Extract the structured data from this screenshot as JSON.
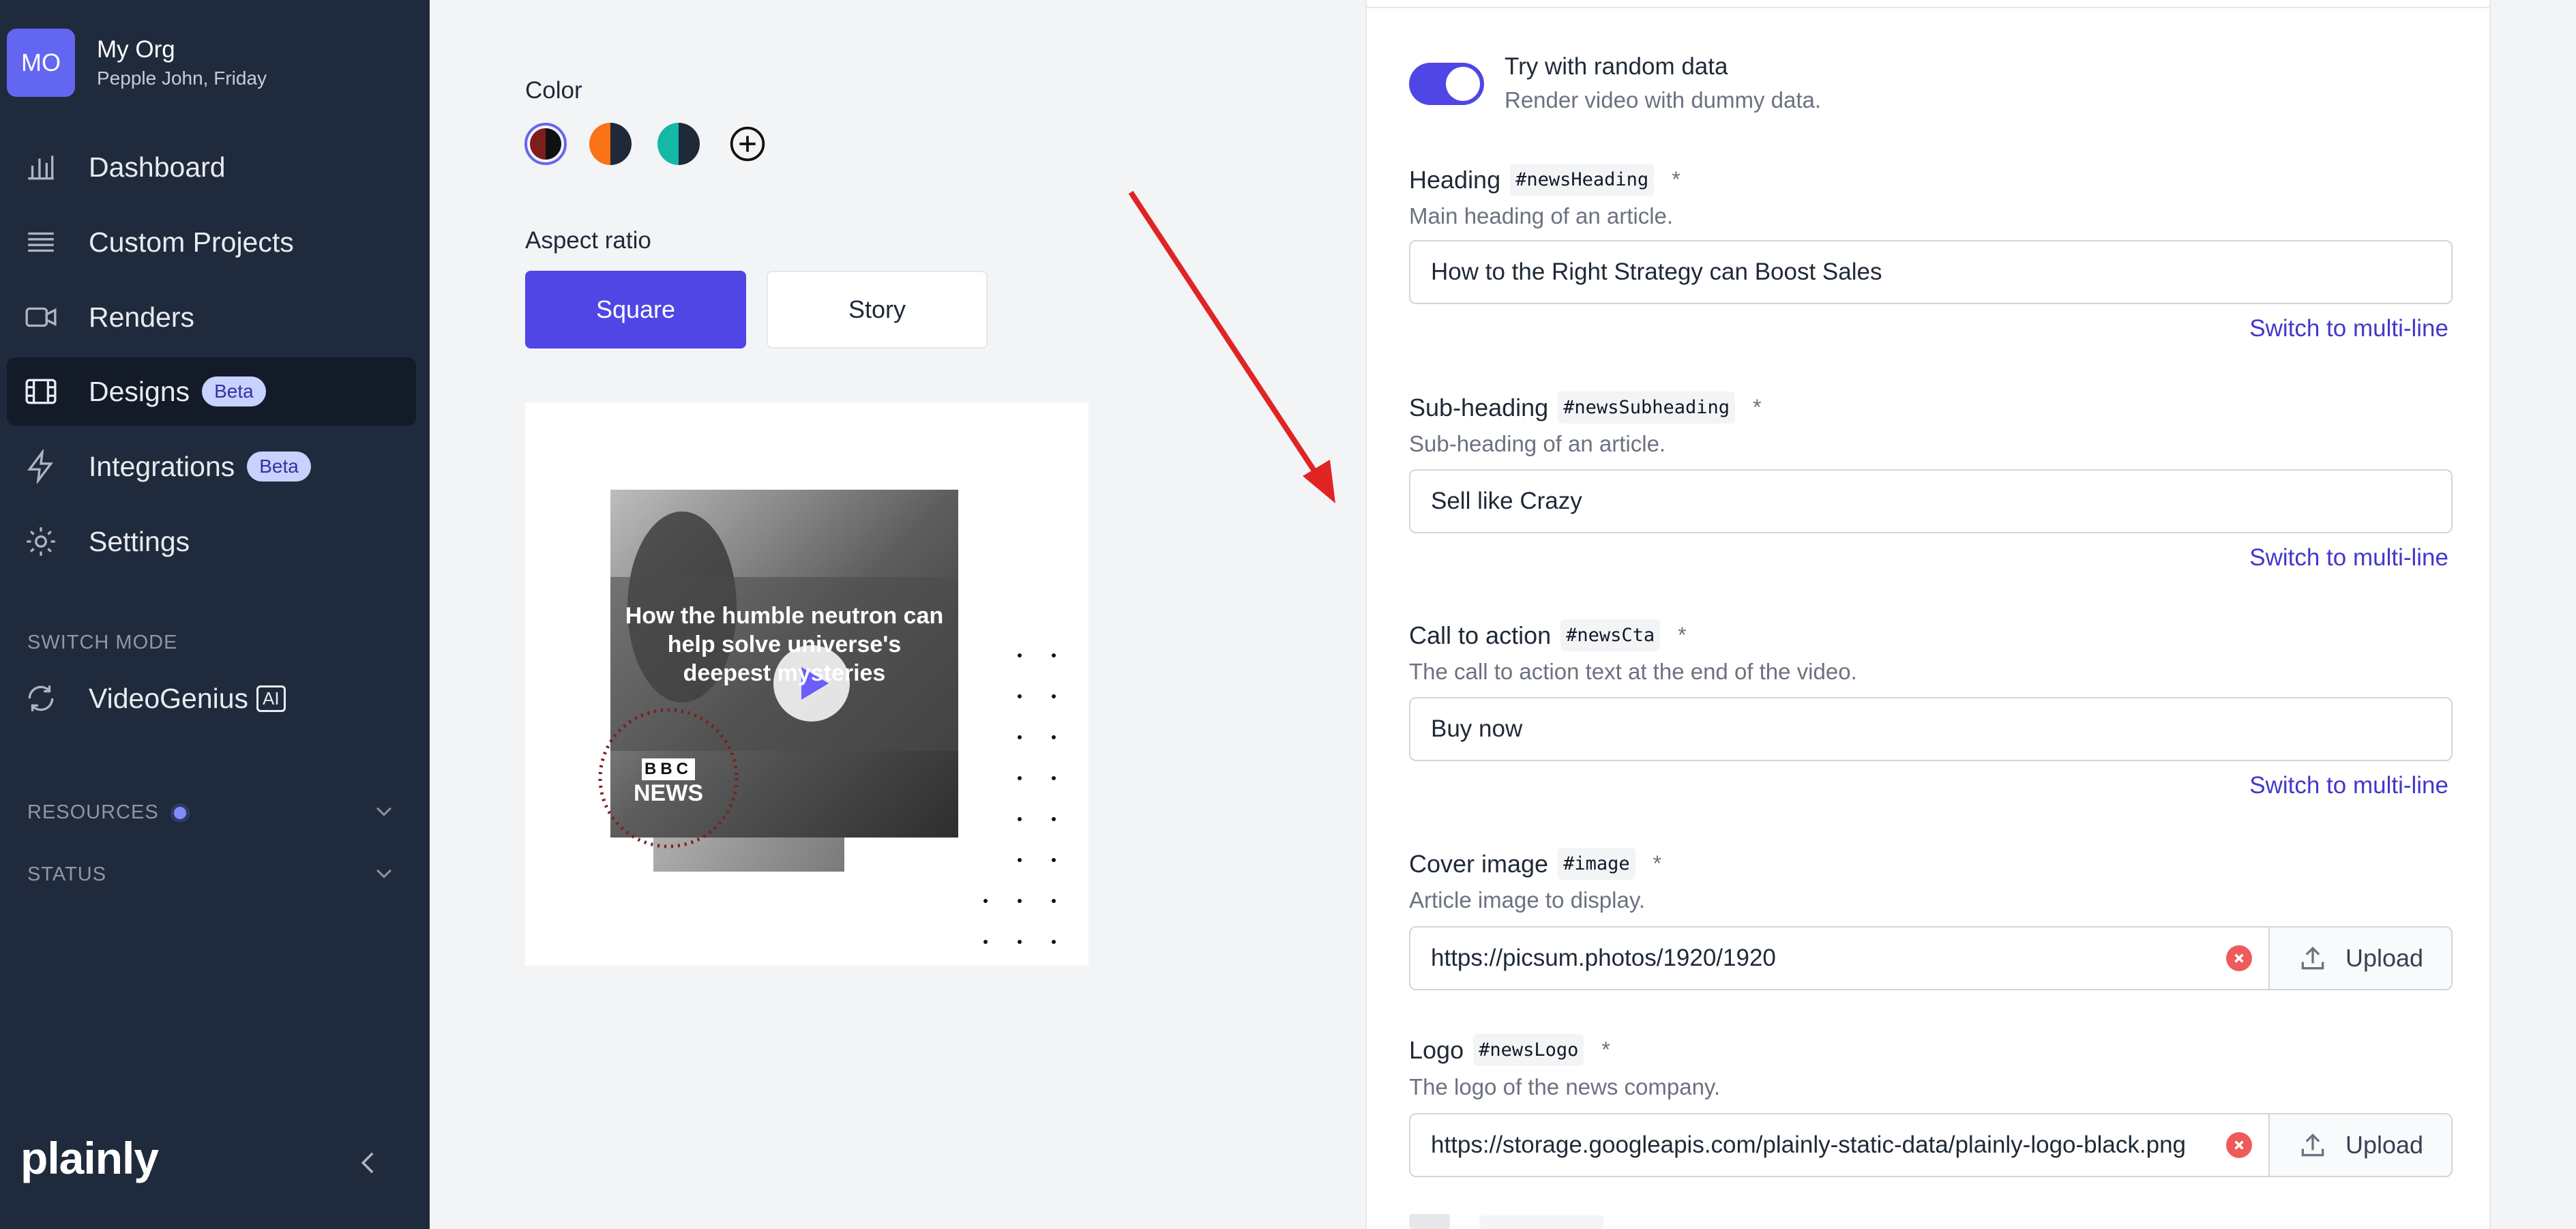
{
  "org": {
    "initials": "MO",
    "name": "My Org",
    "subtitle": "Pepple John, Friday"
  },
  "nav": {
    "dashboard": "Dashboard",
    "custom_projects": "Custom Projects",
    "renders": "Renders",
    "designs": "Designs",
    "designs_badge": "Beta",
    "integrations": "Integrations",
    "integrations_badge": "Beta",
    "settings": "Settings"
  },
  "switch_mode": {
    "label": "SWITCH MODE",
    "item": "VideoGenius",
    "badge": "AI"
  },
  "resources": {
    "label": "RESOURCES"
  },
  "status": {
    "label": "STATUS"
  },
  "brand": "plainly",
  "options": {
    "color_label": "Color",
    "colors": [
      {
        "left": "#7f1d1d",
        "right": "#111111"
      },
      {
        "left": "#f97316",
        "right": "#1f2937"
      },
      {
        "left": "#14b8a6",
        "right": "#1f2937"
      }
    ],
    "aspect_label": "Aspect ratio",
    "aspect_square": "Square",
    "aspect_story": "Story"
  },
  "preview": {
    "headline": "How the humble neutron can help solve universe's deepest mysteries",
    "logo_top": "BBC",
    "logo_bottom": "NEWS"
  },
  "form": {
    "random_title": "Try with random data",
    "random_sub": "Render video with dummy data.",
    "random_enabled": true,
    "switch_label": "Switch to multi-line",
    "required_mark": "*",
    "upload_label": "Upload",
    "heading": {
      "label": "Heading",
      "tag": "#newsHeading",
      "help": "Main heading of an article.",
      "value": "How  to the Right Strategy can Boost Sales"
    },
    "subheading": {
      "label": "Sub-heading",
      "tag": "#newsSubheading",
      "help": "Sub-heading of an article.",
      "value": "Sell like Crazy"
    },
    "cta": {
      "label": "Call to action",
      "tag": "#newsCta",
      "help": "The call to action text at the end of the video.",
      "value": "Buy now"
    },
    "cover": {
      "label": "Cover image",
      "tag": "#image",
      "help": "Article image to display.",
      "value": "https://picsum.photos/1920/1920"
    },
    "logo": {
      "label": "Logo",
      "tag": "#newsLogo",
      "help": "The logo of the news company.",
      "value": "https://storage.googleapis.com/plainly-static-data/plainly-logo-black.png"
    }
  }
}
